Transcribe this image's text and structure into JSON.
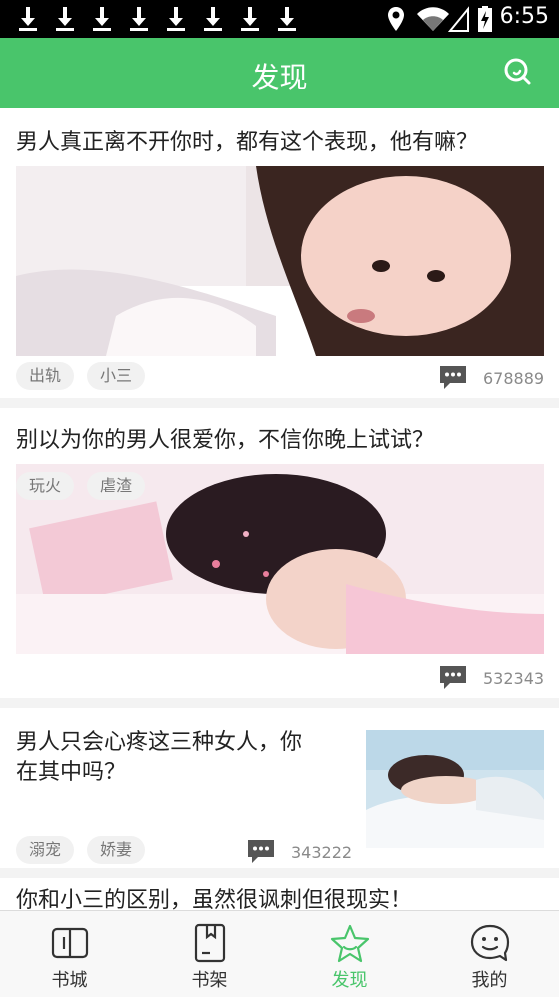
{
  "status_bar": {
    "time": "6:55",
    "download_notifications": 8,
    "icons": [
      "download-icon",
      "location-icon",
      "wifi-icon",
      "signal-icon",
      "battery-charging-icon"
    ]
  },
  "app_bar": {
    "title": "发现",
    "search_icon": "search-icon"
  },
  "feed": {
    "articles": [
      {
        "headline": "男人真正离不开你时，都有这个表现，他有嘛？",
        "tags": [
          "出轨",
          "小三"
        ],
        "comments": "678889",
        "image": "photo-woman-lying-white-sheets"
      },
      {
        "headline": "别以为你的男人很爱你，不信你晚上试试？",
        "tags": [
          "玩火",
          "虐渣"
        ],
        "comments": "532343",
        "image": "photo-woman-lying-pink-room"
      },
      {
        "headline_line1": "男人只会心疼这三种女人，你",
        "headline_line2": "在其中吗？",
        "tags": [
          "溺宠",
          "娇妻"
        ],
        "comments": "343222",
        "image": "photo-woman-sleeping-pillow"
      },
      {
        "headline": "你和小三的区别，虽然很讽刺但很现实！"
      }
    ]
  },
  "tab_bar": {
    "tabs": [
      {
        "label": "书城",
        "icon": "book-icon",
        "active": false
      },
      {
        "label": "书架",
        "icon": "bookshelf-icon",
        "active": false
      },
      {
        "label": "发现",
        "icon": "star-icon",
        "active": true
      },
      {
        "label": "我的",
        "icon": "chat-face-icon",
        "active": false
      }
    ]
  },
  "colors": {
    "accent": "#49c56b",
    "tag_bg": "#f1f1f1",
    "tag_text": "#777777",
    "count_text": "#8a8a8a",
    "headline_text": "#222222"
  }
}
